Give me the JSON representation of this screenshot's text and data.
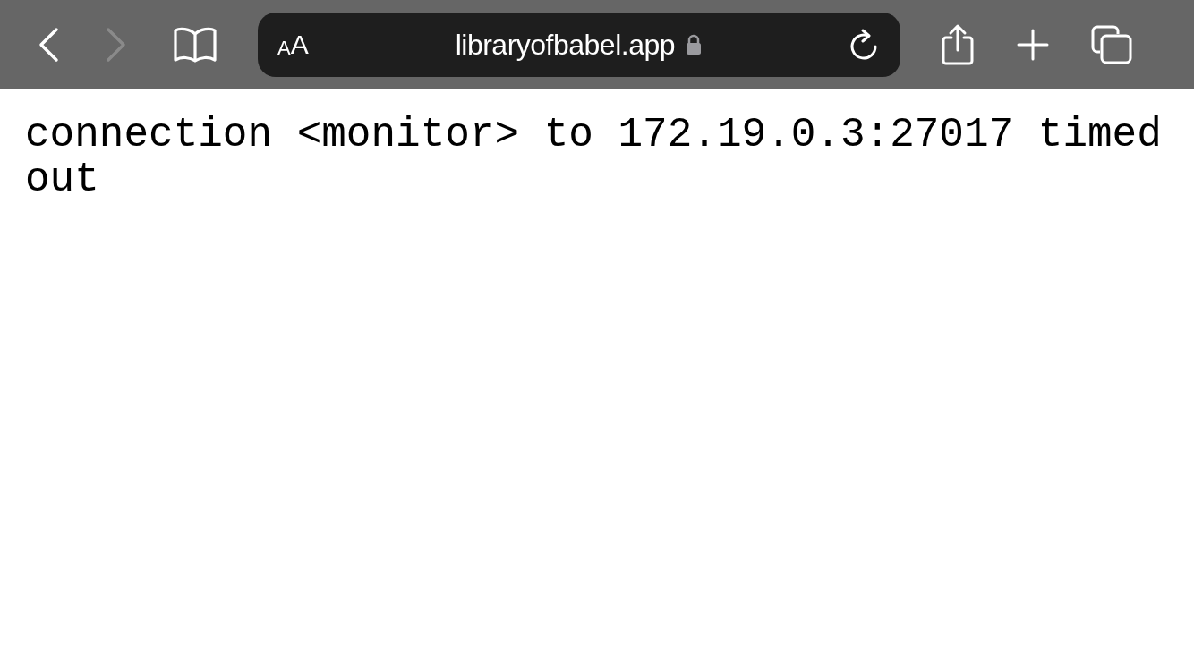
{
  "toolbar": {
    "back": {
      "disabled": false
    },
    "forward": {
      "disabled": true
    },
    "address_bar": {
      "text_size_small": "A",
      "text_size_large": "A",
      "url": "libraryofbabel.app",
      "secure": true
    }
  },
  "page": {
    "message": "connection <monitor> to 172.19.0.3:27017 timed out"
  }
}
